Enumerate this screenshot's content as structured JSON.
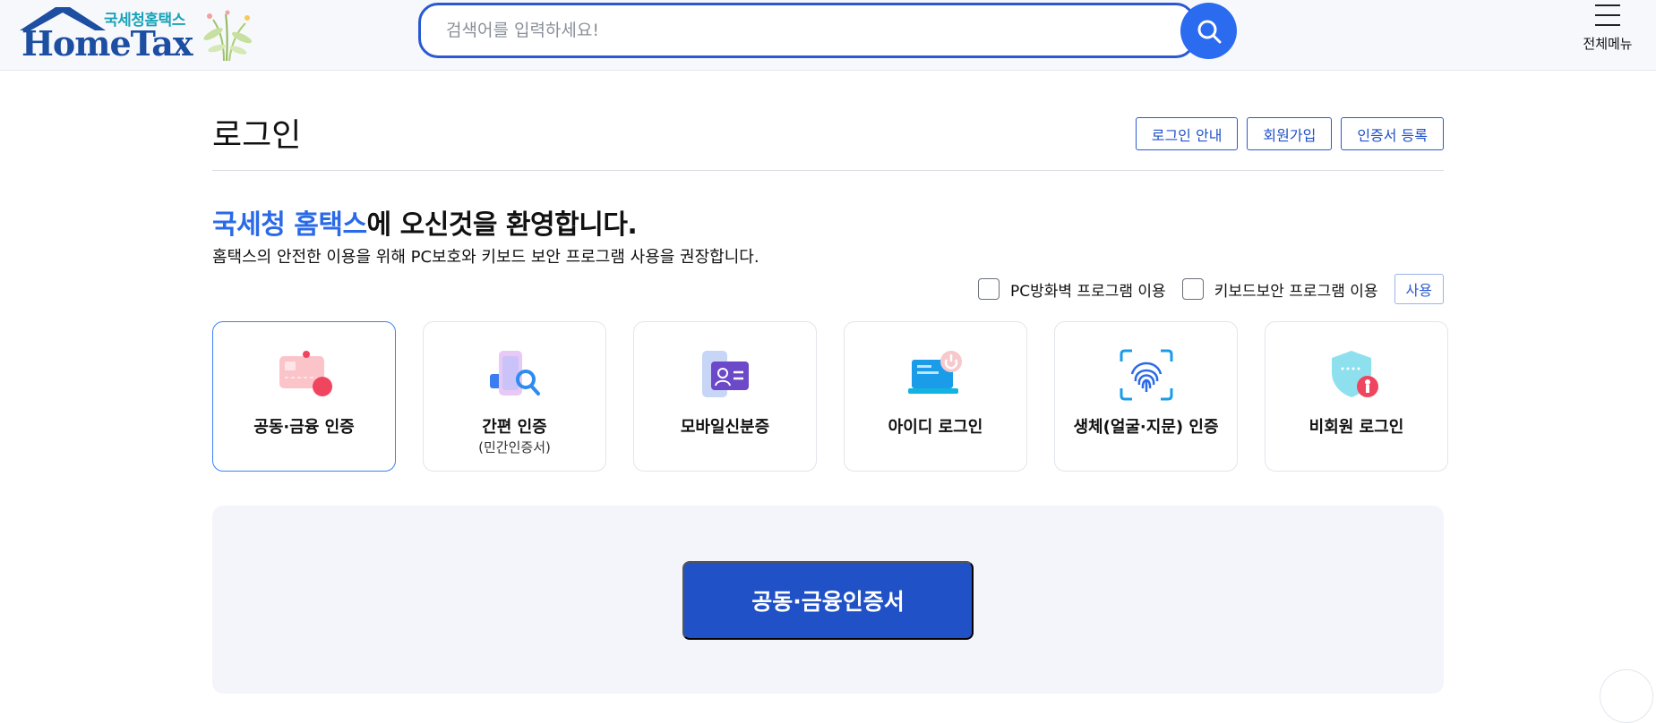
{
  "header": {
    "logo_sub": "국세청홈택스",
    "logo_main": "HomeTax",
    "search_placeholder": "검색어를 입력하세요!",
    "menu_label": "전체메뉴"
  },
  "page": {
    "title": "로그인",
    "top_buttons": [
      "로그인 안내",
      "회원가입",
      "인증서 등록"
    ]
  },
  "welcome": {
    "accent": "국세청 홈택스",
    "rest": "에 오신것을 환영합니다.",
    "description": "홈택스의 안전한 이용을 위해 PC보호와 키보드 보안 프로그램 사용을 권장합니다."
  },
  "options": {
    "firewall_label": "PC방화벽 프로그램 이용",
    "firewall_checked": false,
    "keyboard_label": "키보드보안 프로그램 이용",
    "keyboard_checked": false,
    "use_button": "사용"
  },
  "login_methods": [
    {
      "label": "공동·금융 인증",
      "sub": "",
      "icon": "certificate-card-icon",
      "active": true
    },
    {
      "label": "간편 인증",
      "sub": "(민간인증서)",
      "icon": "phone-magnifier-icon",
      "active": false
    },
    {
      "label": "모바일신분증",
      "sub": "",
      "icon": "mobile-id-icon",
      "active": false
    },
    {
      "label": "아이디 로그인",
      "sub": "",
      "icon": "laptop-power-icon",
      "active": false
    },
    {
      "label": "생체(얼굴·지문) 인증",
      "sub": "",
      "icon": "fingerprint-icon",
      "active": false
    },
    {
      "label": "비회원 로그인",
      "sub": "",
      "icon": "shield-person-icon",
      "active": false
    }
  ],
  "primary_button": "공동·금융인증서",
  "colors": {
    "brand_blue": "#2151c6",
    "accent_blue": "#2a6ae8",
    "logo_teal": "#1aa3b8"
  }
}
